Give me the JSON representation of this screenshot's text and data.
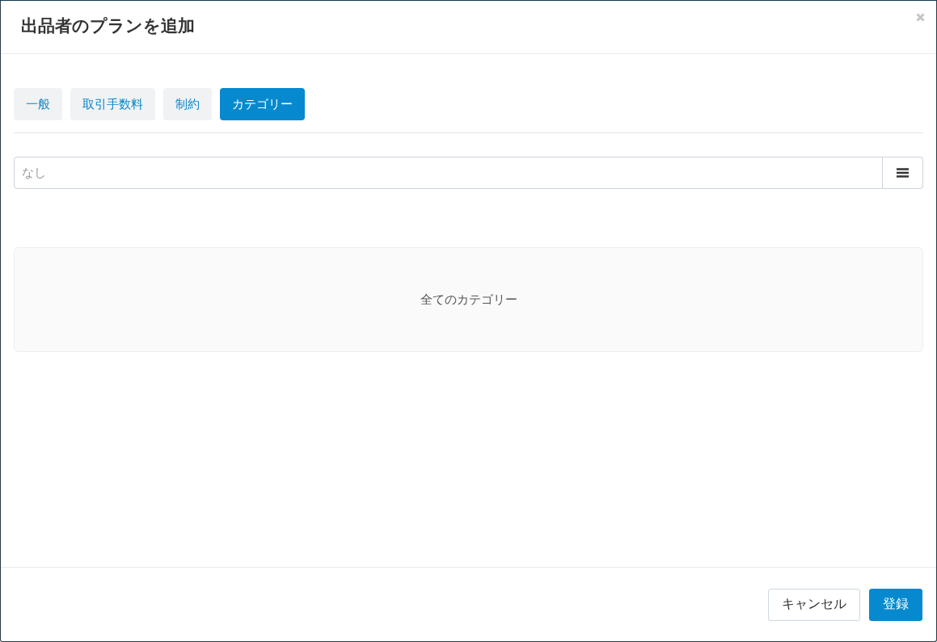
{
  "dialog": {
    "title": "出品者のプランを追加"
  },
  "tabs": [
    {
      "label": "一般",
      "selected": false
    },
    {
      "label": "取引手数料",
      "selected": false
    },
    {
      "label": "制約",
      "selected": false
    },
    {
      "label": "カテゴリー",
      "selected": true
    }
  ],
  "category_field": {
    "placeholder": "なし"
  },
  "category_panel": {
    "text": "全てのカテゴリー"
  },
  "buttons": [
    {
      "label": "キャンセル",
      "kind": "secondary"
    },
    {
      "label": "登録",
      "kind": "primary"
    }
  ]
}
